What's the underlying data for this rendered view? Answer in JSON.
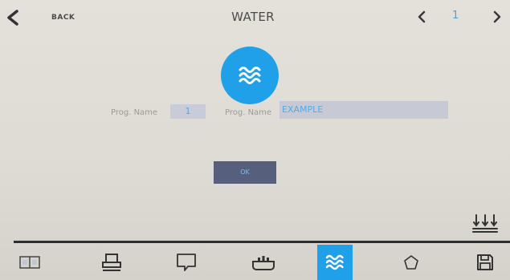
{
  "header": {
    "back_label": "BACK",
    "title": "WATER",
    "page_number": "1"
  },
  "form": {
    "prog_number_label": "Prog. Name",
    "prog_number_value": "1",
    "prog_name_label": "Prog. Name",
    "prog_name_value": "EXAMPLE",
    "ok_label": "OK"
  },
  "colors": {
    "accent": "#1fa0e8",
    "field_bg": "#c7c9d4",
    "ok_bg": "#56607c"
  },
  "bottom_nav": {
    "items": [
      {
        "icon": "book-icon",
        "active": false
      },
      {
        "icon": "tray-icon",
        "active": false
      },
      {
        "icon": "chat-icon",
        "active": false
      },
      {
        "icon": "steam-pan-icon",
        "active": false
      },
      {
        "icon": "water-icon",
        "active": true
      },
      {
        "icon": "pentagon-icon",
        "active": false
      },
      {
        "icon": "save-icon",
        "active": false
      }
    ]
  }
}
